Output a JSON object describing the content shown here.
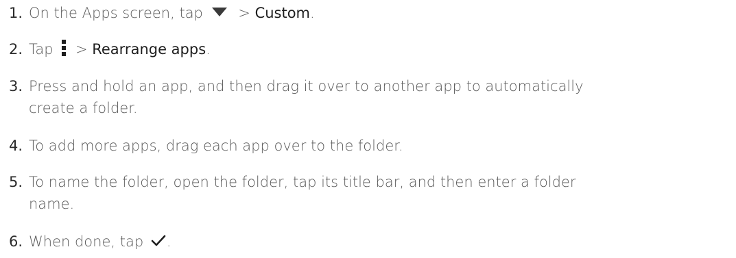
{
  "steps": [
    {
      "number": "1.",
      "text_before": "On the Apps screen, tap",
      "sep": ">",
      "ui": "Custom",
      "text_after": ".",
      "icon": "dropdown-triangle-icon"
    },
    {
      "number": "2.",
      "text_before": "Tap",
      "sep": ">",
      "ui": "Rearrange apps",
      "text_after": ".",
      "icon": "more-vertical-icon"
    },
    {
      "number": "3.",
      "line1": "Press and hold an app, and then drag it over to another app to automatically",
      "line2": "create a folder."
    },
    {
      "number": "4.",
      "text": "To add more apps, drag each app over to the folder."
    },
    {
      "number": "5.",
      "line1": "To name the folder, open the folder, tap its title bar, and then enter a folder",
      "line2": "name."
    },
    {
      "number": "6.",
      "text_before": "When done, tap",
      "text_after": ".",
      "icon": "checkmark-icon"
    }
  ],
  "colors": {
    "text": "#5a5a5a",
    "number": "#2b2b2b",
    "ui_label": "#1e1e1e",
    "icon": "#3a3a3a"
  }
}
